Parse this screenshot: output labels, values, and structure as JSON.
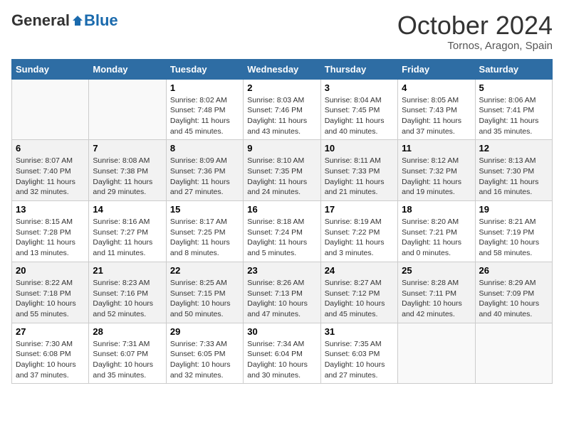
{
  "header": {
    "logo_general": "General",
    "logo_blue": "Blue",
    "month_title": "October 2024",
    "location": "Tornos, Aragon, Spain"
  },
  "weekdays": [
    "Sunday",
    "Monday",
    "Tuesday",
    "Wednesday",
    "Thursday",
    "Friday",
    "Saturday"
  ],
  "weeks": [
    [
      {
        "day": "",
        "info": ""
      },
      {
        "day": "",
        "info": ""
      },
      {
        "day": "1",
        "info": "Sunrise: 8:02 AM\nSunset: 7:48 PM\nDaylight: 11 hours and 45 minutes."
      },
      {
        "day": "2",
        "info": "Sunrise: 8:03 AM\nSunset: 7:46 PM\nDaylight: 11 hours and 43 minutes."
      },
      {
        "day": "3",
        "info": "Sunrise: 8:04 AM\nSunset: 7:45 PM\nDaylight: 11 hours and 40 minutes."
      },
      {
        "day": "4",
        "info": "Sunrise: 8:05 AM\nSunset: 7:43 PM\nDaylight: 11 hours and 37 minutes."
      },
      {
        "day": "5",
        "info": "Sunrise: 8:06 AM\nSunset: 7:41 PM\nDaylight: 11 hours and 35 minutes."
      }
    ],
    [
      {
        "day": "6",
        "info": "Sunrise: 8:07 AM\nSunset: 7:40 PM\nDaylight: 11 hours and 32 minutes."
      },
      {
        "day": "7",
        "info": "Sunrise: 8:08 AM\nSunset: 7:38 PM\nDaylight: 11 hours and 29 minutes."
      },
      {
        "day": "8",
        "info": "Sunrise: 8:09 AM\nSunset: 7:36 PM\nDaylight: 11 hours and 27 minutes."
      },
      {
        "day": "9",
        "info": "Sunrise: 8:10 AM\nSunset: 7:35 PM\nDaylight: 11 hours and 24 minutes."
      },
      {
        "day": "10",
        "info": "Sunrise: 8:11 AM\nSunset: 7:33 PM\nDaylight: 11 hours and 21 minutes."
      },
      {
        "day": "11",
        "info": "Sunrise: 8:12 AM\nSunset: 7:32 PM\nDaylight: 11 hours and 19 minutes."
      },
      {
        "day": "12",
        "info": "Sunrise: 8:13 AM\nSunset: 7:30 PM\nDaylight: 11 hours and 16 minutes."
      }
    ],
    [
      {
        "day": "13",
        "info": "Sunrise: 8:15 AM\nSunset: 7:28 PM\nDaylight: 11 hours and 13 minutes."
      },
      {
        "day": "14",
        "info": "Sunrise: 8:16 AM\nSunset: 7:27 PM\nDaylight: 11 hours and 11 minutes."
      },
      {
        "day": "15",
        "info": "Sunrise: 8:17 AM\nSunset: 7:25 PM\nDaylight: 11 hours and 8 minutes."
      },
      {
        "day": "16",
        "info": "Sunrise: 8:18 AM\nSunset: 7:24 PM\nDaylight: 11 hours and 5 minutes."
      },
      {
        "day": "17",
        "info": "Sunrise: 8:19 AM\nSunset: 7:22 PM\nDaylight: 11 hours and 3 minutes."
      },
      {
        "day": "18",
        "info": "Sunrise: 8:20 AM\nSunset: 7:21 PM\nDaylight: 11 hours and 0 minutes."
      },
      {
        "day": "19",
        "info": "Sunrise: 8:21 AM\nSunset: 7:19 PM\nDaylight: 10 hours and 58 minutes."
      }
    ],
    [
      {
        "day": "20",
        "info": "Sunrise: 8:22 AM\nSunset: 7:18 PM\nDaylight: 10 hours and 55 minutes."
      },
      {
        "day": "21",
        "info": "Sunrise: 8:23 AM\nSunset: 7:16 PM\nDaylight: 10 hours and 52 minutes."
      },
      {
        "day": "22",
        "info": "Sunrise: 8:25 AM\nSunset: 7:15 PM\nDaylight: 10 hours and 50 minutes."
      },
      {
        "day": "23",
        "info": "Sunrise: 8:26 AM\nSunset: 7:13 PM\nDaylight: 10 hours and 47 minutes."
      },
      {
        "day": "24",
        "info": "Sunrise: 8:27 AM\nSunset: 7:12 PM\nDaylight: 10 hours and 45 minutes."
      },
      {
        "day": "25",
        "info": "Sunrise: 8:28 AM\nSunset: 7:11 PM\nDaylight: 10 hours and 42 minutes."
      },
      {
        "day": "26",
        "info": "Sunrise: 8:29 AM\nSunset: 7:09 PM\nDaylight: 10 hours and 40 minutes."
      }
    ],
    [
      {
        "day": "27",
        "info": "Sunrise: 7:30 AM\nSunset: 6:08 PM\nDaylight: 10 hours and 37 minutes."
      },
      {
        "day": "28",
        "info": "Sunrise: 7:31 AM\nSunset: 6:07 PM\nDaylight: 10 hours and 35 minutes."
      },
      {
        "day": "29",
        "info": "Sunrise: 7:33 AM\nSunset: 6:05 PM\nDaylight: 10 hours and 32 minutes."
      },
      {
        "day": "30",
        "info": "Sunrise: 7:34 AM\nSunset: 6:04 PM\nDaylight: 10 hours and 30 minutes."
      },
      {
        "day": "31",
        "info": "Sunrise: 7:35 AM\nSunset: 6:03 PM\nDaylight: 10 hours and 27 minutes."
      },
      {
        "day": "",
        "info": ""
      },
      {
        "day": "",
        "info": ""
      }
    ]
  ]
}
